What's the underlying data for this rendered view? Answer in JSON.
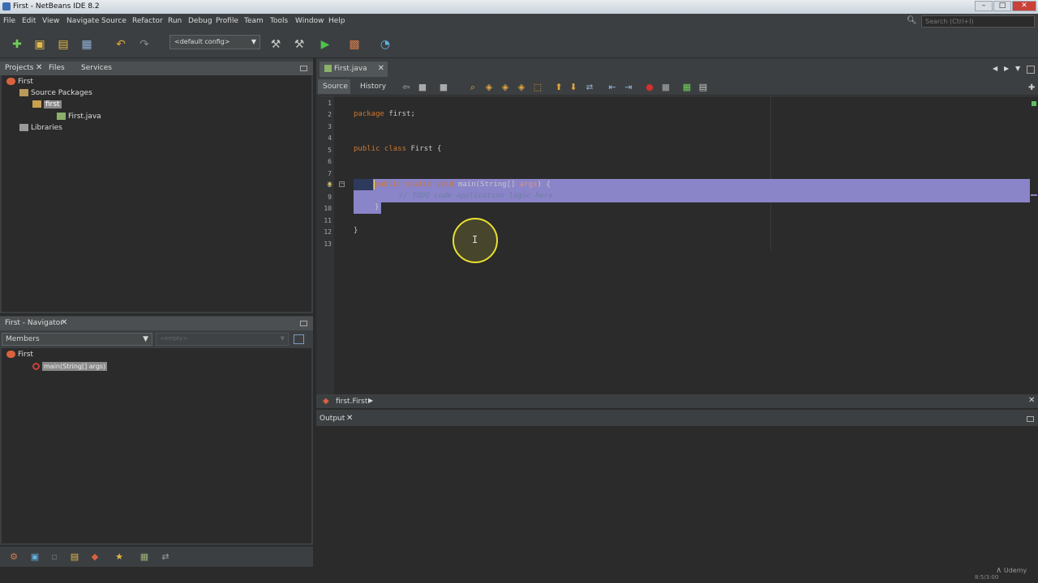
{
  "window": {
    "title": "First - NetBeans IDE 8.2",
    "min": "–",
    "max": "□",
    "close": "✕"
  },
  "menu": [
    "File",
    "Edit",
    "View",
    "Navigate",
    "Source",
    "Refactor",
    "Run",
    "Debug",
    "Profile",
    "Team",
    "Tools",
    "Window",
    "Help"
  ],
  "search": {
    "placeholder": "Search (Ctrl+I)"
  },
  "toolbar": {
    "config": "<default config>"
  },
  "projects": {
    "tabs": [
      "Projects",
      "Files",
      "Services"
    ],
    "tree": {
      "project": "First",
      "source_packages": "Source Packages",
      "package": "first",
      "file": "First.java",
      "libraries": "Libraries"
    }
  },
  "navigator": {
    "title": "First - Navigator",
    "filter": "Members",
    "empty": "<empty>",
    "tree": {
      "class": "First",
      "method": "main(String[] args)"
    }
  },
  "editor": {
    "tab": "First.java",
    "subtabs": [
      "Source",
      "History"
    ],
    "line_numbers": [
      "1",
      "2",
      "3",
      "4",
      "5",
      "6",
      "7",
      "8",
      "9",
      "10",
      "11",
      "12",
      "13"
    ],
    "code": {
      "l2_kw": "package",
      "l2_rest": " first;",
      "l5_kw": "public class",
      "l5_rest": " First {",
      "l8_kw": "public static void",
      "l8_name": " main(String[] ",
      "l8_param": "args",
      "l8_end": ") {",
      "l9": "// TODO code application logic here",
      "l10": "}",
      "l12": "}"
    },
    "breadcrumb": "first.First"
  },
  "output": {
    "tab": "Output"
  },
  "watermark": {
    "brand": "Udemy",
    "time": "8:5/3:00"
  },
  "colors": {
    "selection": "#8a84c8",
    "background": "#2b2b2b",
    "panel": "#3c3f41",
    "keyword": "#cc7832"
  }
}
